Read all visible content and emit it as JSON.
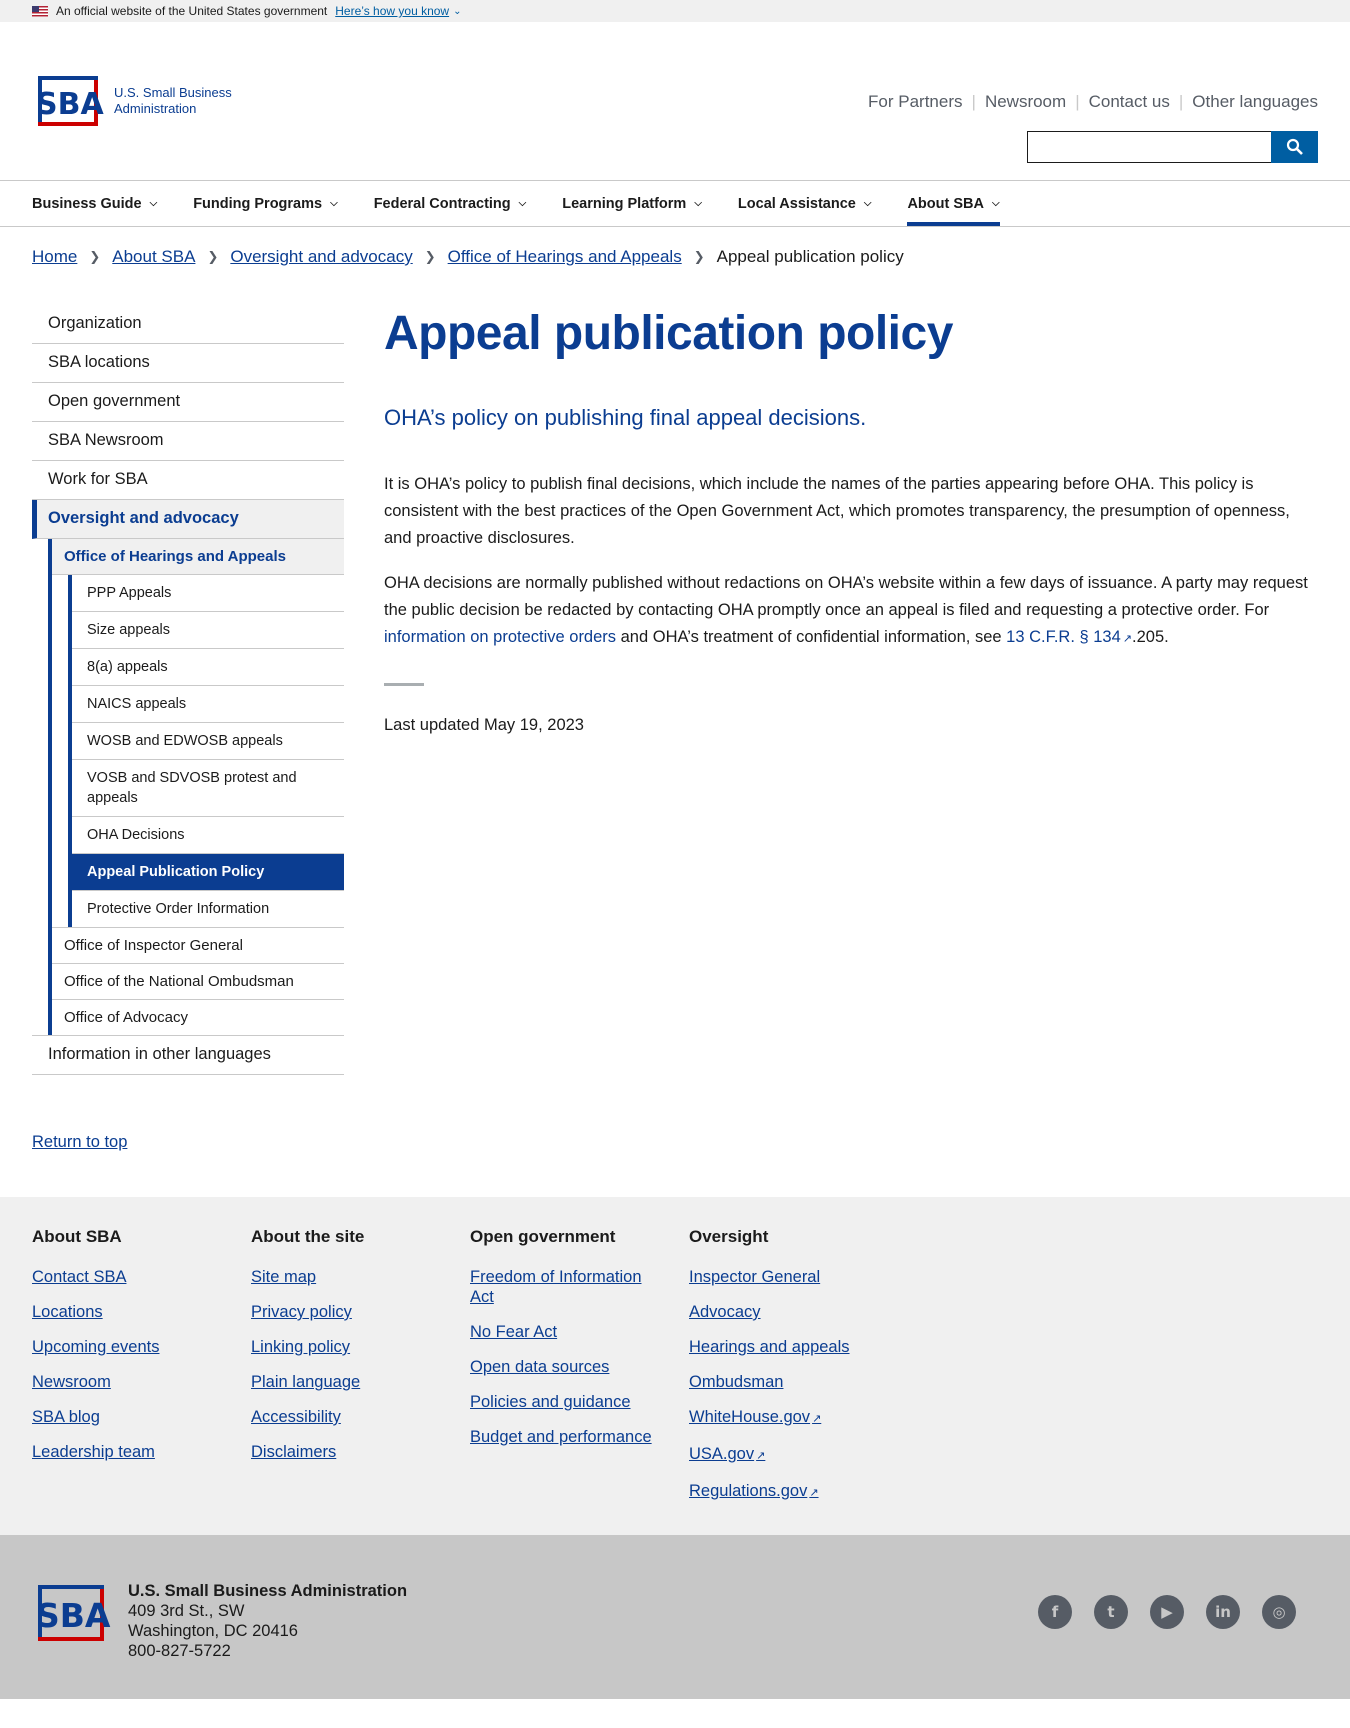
{
  "gov_banner": {
    "text": "An official website of the United States government",
    "link": "Here’s how you know"
  },
  "header": {
    "agency_name": "U.S. Small Business Administration",
    "utility_links": [
      "For Partners",
      "Newsroom",
      "Contact us",
      "Other languages"
    ],
    "search_placeholder": ""
  },
  "primary_nav": [
    "Business Guide",
    "Funding Programs",
    "Federal Contracting",
    "Learning Platform",
    "Local Assistance",
    "About SBA"
  ],
  "breadcrumb": {
    "links": [
      "Home",
      "About SBA",
      "Oversight and advocacy",
      "Office of Hearings and Appeals"
    ],
    "current": "Appeal publication policy"
  },
  "sidenav": {
    "top": [
      "Organization",
      "SBA locations",
      "Open government",
      "SBA Newsroom",
      "Work for SBA"
    ],
    "current_l1": "Oversight and advocacy",
    "current_l2": "Office of Hearings and Appeals",
    "l3": [
      "PPP Appeals",
      "Size appeals",
      "8(a) appeals",
      "NAICS appeals",
      "WOSB and EDWOSB appeals",
      "VOSB and SDVOSB protest and appeals",
      "OHA Decisions",
      "Appeal Publication Policy",
      "Protective Order Information"
    ],
    "l2_rest": [
      "Office of Inspector General",
      "Office of the National Ombudsman",
      "Office of Advocacy"
    ],
    "bottom": "Information in other languages"
  },
  "main": {
    "title": "Appeal publication policy",
    "lede": "OHA’s policy on publishing final appeal decisions.",
    "p1": "It is OHA’s policy to publish final decisions, which include the names of the parties appearing before OHA. This policy is consistent with the best practices of the Open Government Act, which promotes transparency, the presumption of openness, and proactive disclosures.",
    "p2_a": "OHA decisions are normally published without redactions on OHA’s website within a few days of issuance. A party may request the public decision be redacted by contacting OHA promptly once an appeal is filed and requesting a protective order. For ",
    "p2_link1": "information on protective orders ",
    "p2_b": "and OHA’s treatment of confidential information, see ",
    "p2_link2": "13 C.F.R. § 134",
    "p2_c": ".205.",
    "updated": "Last updated May 19, 2023"
  },
  "return_top": "Return to top",
  "footer": {
    "columns": [
      {
        "title": "About SBA",
        "links": [
          "Contact SBA",
          "Locations",
          "Upcoming events",
          "Newsroom",
          "SBA blog",
          "Leadership team"
        ]
      },
      {
        "title": "About the site",
        "links": [
          "Site map",
          "Privacy policy",
          "Linking policy",
          "Plain language",
          "Accessibility",
          "Disclaimers"
        ]
      },
      {
        "title": "Open government",
        "links": [
          "Freedom of Information Act",
          "No Fear Act",
          "Open data sources",
          "Policies and guidance",
          "Budget and performance"
        ]
      },
      {
        "title": "Oversight",
        "links": [
          "Inspector General",
          "Advocacy",
          "Hearings and appeals",
          "Ombudsman",
          "WhiteHouse.gov",
          "USA.gov",
          "Regulations.gov"
        ]
      }
    ],
    "address": {
      "org": "U.S. Small Business Administration",
      "street": "409 3rd St., SW",
      "city": "Washington, DC 20416",
      "phone": "800-827-5722"
    },
    "social": [
      "facebook-icon",
      "twitter-icon",
      "youtube-icon",
      "linkedin-icon",
      "instagram-icon"
    ]
  },
  "colors": {
    "brand_blue": "#0b3d91",
    "action_blue": "#005ea2",
    "brand_red": "#cc0000"
  }
}
